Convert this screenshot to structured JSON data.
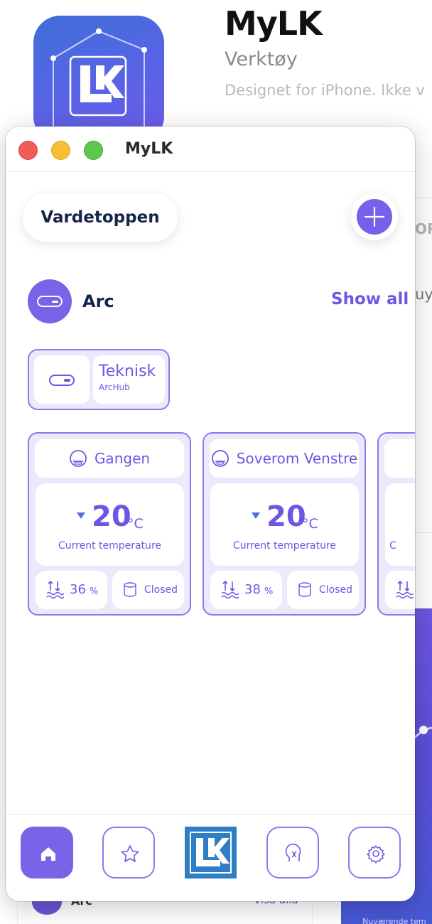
{
  "background": {
    "app_name": "MyLK",
    "category": "Verktøy",
    "description": "Designet for iPhone. Ikke v",
    "right_header": "OR",
    "right_text": "uy",
    "bottom_section_title": "Arc",
    "bottom_show_all": "Visa alla",
    "bottom_caption": "Nuværende tem"
  },
  "window": {
    "title": "MyLK",
    "location_button": "Vardetoppen",
    "section": {
      "title": "Arc",
      "show_all": "Show all"
    },
    "hub": {
      "name": "Teknisk",
      "type": "ArcHub"
    },
    "rooms": [
      {
        "name": "Gangen",
        "temperature": "20",
        "unit": "°C",
        "temp_label": "Current temperature",
        "humidity": "36",
        "humidity_unit": "%",
        "valve": "Closed"
      },
      {
        "name": "Soverom Venstre",
        "temperature": "20",
        "unit": "°C",
        "temp_label": "Current temperature",
        "humidity": "38",
        "humidity_unit": "%",
        "valve": "Closed"
      },
      {
        "name": "",
        "temperature": "",
        "unit": "",
        "temp_label": "C",
        "humidity": "",
        "humidity_unit": "",
        "valve": ""
      }
    ],
    "tabbar": {
      "items": [
        "home-icon",
        "star-icon",
        "lk-logo",
        "support-icon",
        "gear-icon"
      ],
      "active": "home-icon"
    }
  },
  "colors": {
    "accent": "#7964e8",
    "accent_text": "#6d56e4",
    "card_fill": "#ede9fd",
    "dark_text": "#152449",
    "lk_blue": "#2f7dc4"
  }
}
